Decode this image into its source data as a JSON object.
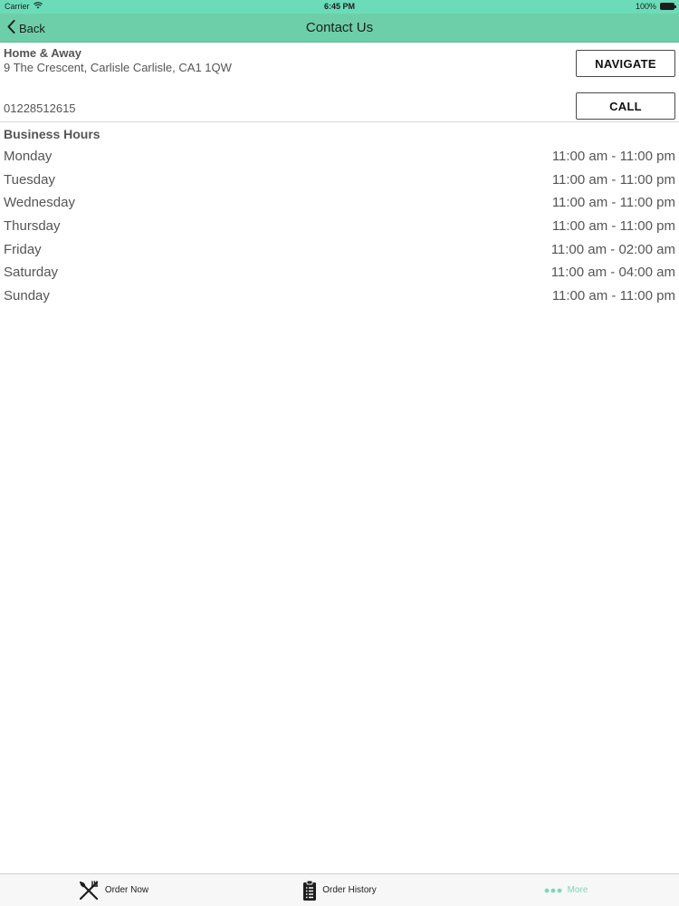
{
  "status_bar": {
    "carrier": "Carrier",
    "time": "6:45 PM",
    "battery": "100%"
  },
  "nav": {
    "back_label": "Back",
    "title": "Contact Us"
  },
  "store": {
    "name": "Home & Away",
    "address": "9 The Crescent, Carlisle Carlisle, CA1 1QW",
    "phone": "01228512615",
    "navigate_label": "NAVIGATE",
    "call_label": "CALL"
  },
  "hours": {
    "title": "Business Hours",
    "days": [
      {
        "day": "Monday",
        "time": "11:00 am - 11:00 pm"
      },
      {
        "day": "Tuesday",
        "time": "11:00 am - 11:00 pm"
      },
      {
        "day": "Wednesday",
        "time": "11:00 am - 11:00 pm"
      },
      {
        "day": "Thursday",
        "time": "11:00 am - 11:00 pm"
      },
      {
        "day": "Friday",
        "time": "11:00 am - 02:00 am"
      },
      {
        "day": "Saturday",
        "time": "11:00 am - 04:00 am"
      },
      {
        "day": "Sunday",
        "time": "11:00 am - 11:00 pm"
      }
    ]
  },
  "tabs": [
    {
      "label": "Order Now",
      "icon": "fork-knife-icon"
    },
    {
      "label": "Order History",
      "icon": "clipboard-icon"
    },
    {
      "label": "More",
      "icon": "more-dots-icon"
    }
  ],
  "colors": {
    "accent": "#6dcfa9",
    "tab_active": "#7ad9bd"
  }
}
